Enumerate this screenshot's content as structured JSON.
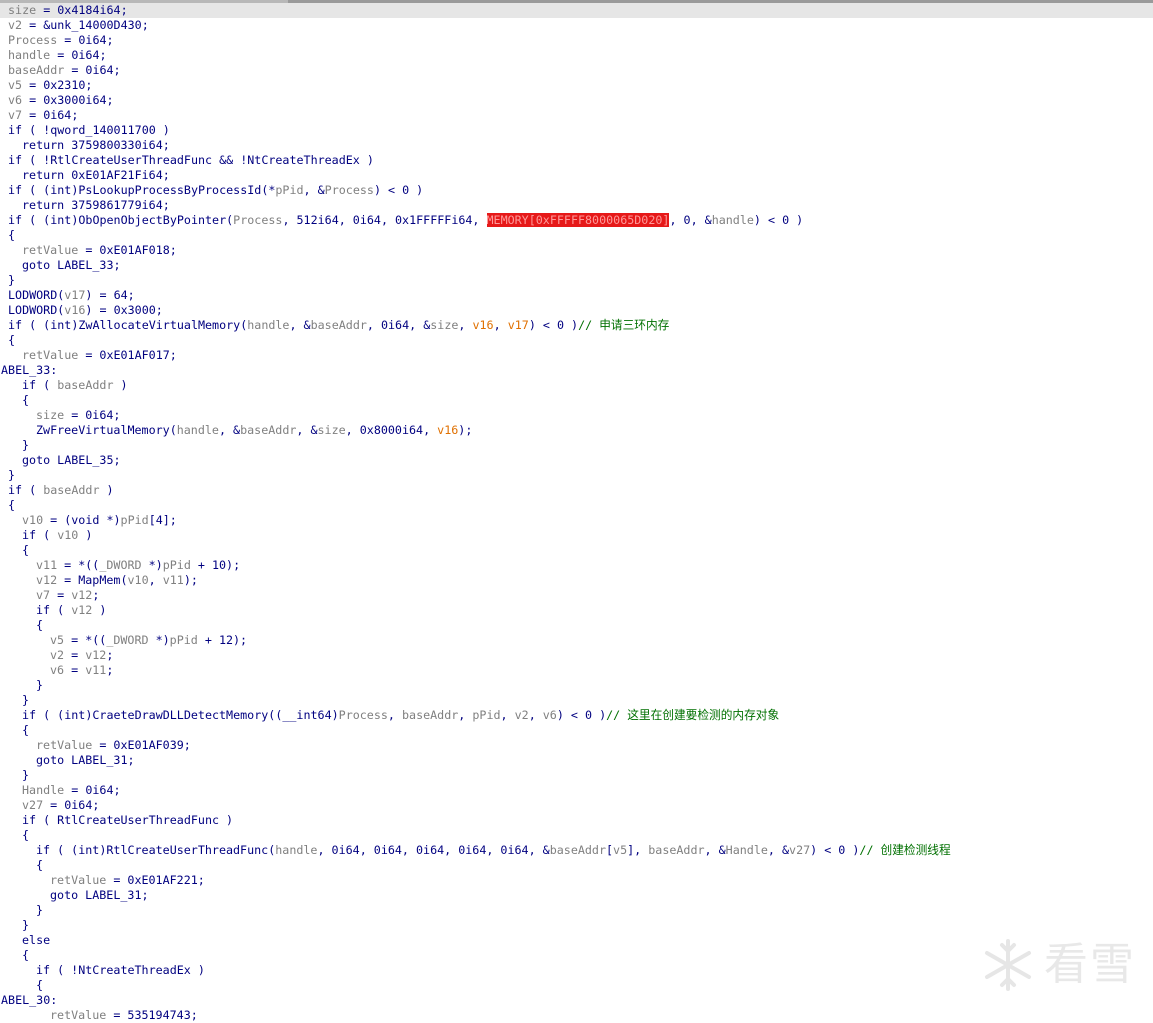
{
  "watermark": {
    "text": "看雪"
  },
  "lines": [
    {
      "i": 0,
      "sel": true,
      "t": [
        [
          "v",
          "size"
        ],
        [
          "m",
          " = 0x4184i64;"
        ]
      ]
    },
    {
      "i": 0,
      "t": [
        [
          "v",
          "v2"
        ],
        [
          "m",
          " = &unk_14000D430;"
        ]
      ]
    },
    {
      "i": 0,
      "t": [
        [
          "v",
          "Process"
        ],
        [
          "m",
          " = 0i64;"
        ]
      ]
    },
    {
      "i": 0,
      "t": [
        [
          "v",
          "handle"
        ],
        [
          "m",
          " = 0i64;"
        ]
      ]
    },
    {
      "i": 0,
      "t": [
        [
          "v",
          "baseAddr"
        ],
        [
          "m",
          " = 0i64;"
        ]
      ]
    },
    {
      "i": 0,
      "t": [
        [
          "v",
          "v5"
        ],
        [
          "m",
          " = 0x2310;"
        ]
      ]
    },
    {
      "i": 0,
      "t": [
        [
          "v",
          "v6"
        ],
        [
          "m",
          " = 0x3000i64;"
        ]
      ]
    },
    {
      "i": 0,
      "t": [
        [
          "v",
          "v7"
        ],
        [
          "m",
          " = 0i64;"
        ]
      ]
    },
    {
      "i": 0,
      "t": [
        [
          "m",
          "if ( !qword_140011700 )"
        ]
      ]
    },
    {
      "i": 1,
      "t": [
        [
          "m",
          "return 3759800330i64;"
        ]
      ]
    },
    {
      "i": 0,
      "t": [
        [
          "m",
          "if ( !RtlCreateUserThreadFunc && !NtCreateThreadEx )"
        ]
      ]
    },
    {
      "i": 1,
      "t": [
        [
          "m",
          "return 0xE01AF21Fi64;"
        ]
      ]
    },
    {
      "i": 0,
      "t": [
        [
          "m",
          "if ( (int)PsLookupProcessByProcessId(*"
        ],
        [
          "v",
          "pPid"
        ],
        [
          "m",
          ", &"
        ],
        [
          "v",
          "Process"
        ],
        [
          "m",
          ") < 0 )"
        ]
      ]
    },
    {
      "i": 1,
      "t": [
        [
          "m",
          "return 3759861779i64;"
        ]
      ]
    },
    {
      "i": 0,
      "t": [
        [
          "m",
          "if ( (int)ObOpenObjectByPointer("
        ],
        [
          "v",
          "Process"
        ],
        [
          "m",
          ", 512i64, 0i64, 0x1FFFFFi64, "
        ],
        [
          "h",
          "MEMORY[0xFFFFF8000065D020]"
        ],
        [
          "m",
          ", 0, &"
        ],
        [
          "v",
          "handle"
        ],
        [
          "m",
          ") < 0 )"
        ]
      ]
    },
    {
      "i": 0,
      "t": [
        [
          "m",
          "{"
        ]
      ]
    },
    {
      "i": 1,
      "t": [
        [
          "v",
          "retValue"
        ],
        [
          "m",
          " = 0xE01AF018;"
        ]
      ]
    },
    {
      "i": 1,
      "t": [
        [
          "m",
          "goto LABEL_33;"
        ]
      ]
    },
    {
      "i": 0,
      "t": [
        [
          "m",
          "}"
        ]
      ]
    },
    {
      "i": 0,
      "t": [
        [
          "m",
          "LODWORD("
        ],
        [
          "v",
          "v17"
        ],
        [
          "m",
          ") = 64;"
        ]
      ]
    },
    {
      "i": 0,
      "t": [
        [
          "m",
          "LODWORD("
        ],
        [
          "v",
          "v16"
        ],
        [
          "m",
          ") = 0x3000;"
        ]
      ]
    },
    {
      "i": 0,
      "t": [
        [
          "m",
          "if ( (int)ZwAllocateVirtualMemory("
        ],
        [
          "v",
          "handle"
        ],
        [
          "m",
          ", &"
        ],
        [
          "v",
          "baseAddr"
        ],
        [
          "m",
          ", 0i64, &"
        ],
        [
          "v",
          "size"
        ],
        [
          "m",
          ", "
        ],
        [
          "o",
          "v16"
        ],
        [
          "m",
          ", "
        ],
        [
          "o",
          "v17"
        ],
        [
          "m",
          ") < 0 )"
        ],
        [
          "c",
          "// 申请三环内存"
        ]
      ]
    },
    {
      "i": 0,
      "t": [
        [
          "m",
          "{"
        ]
      ]
    },
    {
      "i": 1,
      "t": [
        [
          "v",
          "retValue"
        ],
        [
          "m",
          " = 0xE01AF017;"
        ]
      ]
    },
    {
      "i": -1,
      "t": [
        [
          "m",
          "ABEL_33:"
        ]
      ]
    },
    {
      "i": 1,
      "t": [
        [
          "m",
          "if ( "
        ],
        [
          "v",
          "baseAddr"
        ],
        [
          "m",
          " )"
        ]
      ]
    },
    {
      "i": 1,
      "t": [
        [
          "m",
          "{"
        ]
      ]
    },
    {
      "i": 2,
      "t": [
        [
          "v",
          "size"
        ],
        [
          "m",
          " = 0i64;"
        ]
      ]
    },
    {
      "i": 2,
      "t": [
        [
          "m",
          "ZwFreeVirtualMemory("
        ],
        [
          "v",
          "handle"
        ],
        [
          "m",
          ", &"
        ],
        [
          "v",
          "baseAddr"
        ],
        [
          "m",
          ", &"
        ],
        [
          "v",
          "size"
        ],
        [
          "m",
          ", 0x8000i64, "
        ],
        [
          "o",
          "v16"
        ],
        [
          "m",
          ");"
        ]
      ]
    },
    {
      "i": 1,
      "t": [
        [
          "m",
          "}"
        ]
      ]
    },
    {
      "i": 1,
      "t": [
        [
          "m",
          "goto LABEL_35;"
        ]
      ]
    },
    {
      "i": 0,
      "t": [
        [
          "m",
          "}"
        ]
      ]
    },
    {
      "i": 0,
      "t": [
        [
          "m",
          "if ( "
        ],
        [
          "v",
          "baseAddr"
        ],
        [
          "m",
          " )"
        ]
      ]
    },
    {
      "i": 0,
      "t": [
        [
          "m",
          "{"
        ]
      ]
    },
    {
      "i": 1,
      "t": [
        [
          "v",
          "v10"
        ],
        [
          "m",
          " = (void *)"
        ],
        [
          "v",
          "pPid"
        ],
        [
          "m",
          "[4];"
        ]
      ]
    },
    {
      "i": 1,
      "t": [
        [
          "m",
          "if ( "
        ],
        [
          "v",
          "v10"
        ],
        [
          "m",
          " )"
        ]
      ]
    },
    {
      "i": 1,
      "t": [
        [
          "m",
          "{"
        ]
      ]
    },
    {
      "i": 2,
      "t": [
        [
          "v",
          "v11"
        ],
        [
          "m",
          " = *(("
        ],
        [
          "v",
          "_DWORD"
        ],
        [
          "m",
          " *)"
        ],
        [
          "v",
          "pPid"
        ],
        [
          "m",
          " + 10);"
        ]
      ]
    },
    {
      "i": 2,
      "t": [
        [
          "v",
          "v12"
        ],
        [
          "m",
          " = MapMem("
        ],
        [
          "v",
          "v10"
        ],
        [
          "m",
          ", "
        ],
        [
          "v",
          "v11"
        ],
        [
          "m",
          ");"
        ]
      ]
    },
    {
      "i": 2,
      "t": [
        [
          "v",
          "v7"
        ],
        [
          "m",
          " = "
        ],
        [
          "v",
          "v12"
        ],
        [
          "m",
          ";"
        ]
      ]
    },
    {
      "i": 2,
      "t": [
        [
          "m",
          "if ( "
        ],
        [
          "v",
          "v12"
        ],
        [
          "m",
          " )"
        ]
      ]
    },
    {
      "i": 2,
      "t": [
        [
          "m",
          "{"
        ]
      ]
    },
    {
      "i": 3,
      "t": [
        [
          "v",
          "v5"
        ],
        [
          "m",
          " = *(("
        ],
        [
          "v",
          "_DWORD"
        ],
        [
          "m",
          " *)"
        ],
        [
          "v",
          "pPid"
        ],
        [
          "m",
          " + 12);"
        ]
      ]
    },
    {
      "i": 3,
      "t": [
        [
          "v",
          "v2"
        ],
        [
          "m",
          " = "
        ],
        [
          "v",
          "v12"
        ],
        [
          "m",
          ";"
        ]
      ]
    },
    {
      "i": 3,
      "t": [
        [
          "v",
          "v6"
        ],
        [
          "m",
          " = "
        ],
        [
          "v",
          "v11"
        ],
        [
          "m",
          ";"
        ]
      ]
    },
    {
      "i": 2,
      "t": [
        [
          "m",
          "}"
        ]
      ]
    },
    {
      "i": 1,
      "t": [
        [
          "m",
          "}"
        ]
      ]
    },
    {
      "i": 1,
      "t": [
        [
          "m",
          "if ( (int)CraeteDrawDLLDetectMemory((__int64)"
        ],
        [
          "v",
          "Process"
        ],
        [
          "m",
          ", "
        ],
        [
          "v",
          "baseAddr"
        ],
        [
          "m",
          ", "
        ],
        [
          "v",
          "pPid"
        ],
        [
          "m",
          ", "
        ],
        [
          "v",
          "v2"
        ],
        [
          "m",
          ", "
        ],
        [
          "v",
          "v6"
        ],
        [
          "m",
          ") < 0 )"
        ],
        [
          "c",
          "// 这里在创建要检测的内存对象"
        ]
      ]
    },
    {
      "i": 1,
      "t": [
        [
          "m",
          "{"
        ]
      ]
    },
    {
      "i": 2,
      "t": [
        [
          "v",
          "retValue"
        ],
        [
          "m",
          " = 0xE01AF039;"
        ]
      ]
    },
    {
      "i": 2,
      "t": [
        [
          "m",
          "goto LABEL_31;"
        ]
      ]
    },
    {
      "i": 1,
      "t": [
        [
          "m",
          "}"
        ]
      ]
    },
    {
      "i": 1,
      "t": [
        [
          "v",
          "Handle"
        ],
        [
          "m",
          " = 0i64;"
        ]
      ]
    },
    {
      "i": 1,
      "t": [
        [
          "v",
          "v27"
        ],
        [
          "m",
          " = 0i64;"
        ]
      ]
    },
    {
      "i": 1,
      "t": [
        [
          "m",
          "if ( RtlCreateUserThreadFunc )"
        ]
      ]
    },
    {
      "i": 1,
      "t": [
        [
          "m",
          "{"
        ]
      ]
    },
    {
      "i": 2,
      "t": [
        [
          "m",
          "if ( (int)RtlCreateUserThreadFunc("
        ],
        [
          "v",
          "handle"
        ],
        [
          "m",
          ", 0i64, 0i64, 0i64, 0i64, 0i64, &"
        ],
        [
          "v",
          "baseAddr"
        ],
        [
          "m",
          "["
        ],
        [
          "v",
          "v5"
        ],
        [
          "m",
          "], "
        ],
        [
          "v",
          "baseAddr"
        ],
        [
          "m",
          ", &"
        ],
        [
          "v",
          "Handle"
        ],
        [
          "m",
          ", &"
        ],
        [
          "v",
          "v27"
        ],
        [
          "m",
          ") < 0 )"
        ],
        [
          "c",
          "// 创建检测线程"
        ]
      ]
    },
    {
      "i": 2,
      "t": [
        [
          "m",
          "{"
        ]
      ]
    },
    {
      "i": 3,
      "t": [
        [
          "v",
          "retValue"
        ],
        [
          "m",
          " = 0xE01AF221;"
        ]
      ]
    },
    {
      "i": 3,
      "t": [
        [
          "m",
          "goto LABEL_31;"
        ]
      ]
    },
    {
      "i": 2,
      "t": [
        [
          "m",
          "}"
        ]
      ]
    },
    {
      "i": 1,
      "t": [
        [
          "m",
          "}"
        ]
      ]
    },
    {
      "i": 1,
      "t": [
        [
          "m",
          "else"
        ]
      ]
    },
    {
      "i": 1,
      "t": [
        [
          "m",
          "{"
        ]
      ]
    },
    {
      "i": 2,
      "t": [
        [
          "m",
          "if ( !NtCreateThreadEx )"
        ]
      ]
    },
    {
      "i": 2,
      "t": [
        [
          "m",
          "{"
        ]
      ]
    },
    {
      "i": -1,
      "t": [
        [
          "m",
          "ABEL_30:"
        ]
      ]
    },
    {
      "i": 3,
      "t": [
        [
          "v",
          "retValue"
        ],
        [
          "m",
          " = 535194743;"
        ]
      ]
    }
  ]
}
